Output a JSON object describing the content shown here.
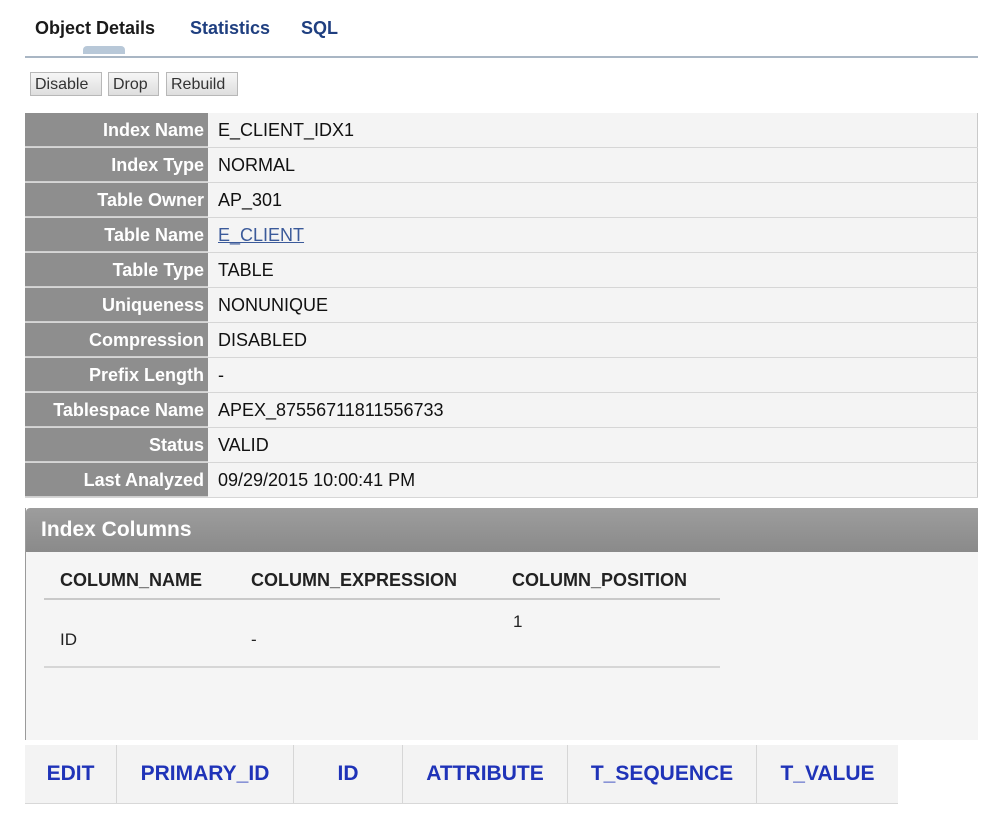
{
  "tabs": [
    "Object Details",
    "Statistics",
    "SQL"
  ],
  "toolbar": {
    "disable": "Disable",
    "drop": "Drop",
    "rebuild": "Rebuild"
  },
  "details": [
    {
      "label": "Index Name",
      "value": "E_CLIENT_IDX1"
    },
    {
      "label": "Index Type",
      "value": "NORMAL"
    },
    {
      "label": "Table Owner",
      "value": "AP_301"
    },
    {
      "label": "Table Name",
      "value": "E_CLIENT"
    },
    {
      "label": "Table Type",
      "value": "TABLE"
    },
    {
      "label": "Uniqueness",
      "value": "NONUNIQUE"
    },
    {
      "label": "Compression",
      "value": "DISABLED"
    },
    {
      "label": "Prefix Length",
      "value": "-"
    },
    {
      "label": "Tablespace Name",
      "value": "APEX_87556711811556733"
    },
    {
      "label": "Status",
      "value": "VALID"
    },
    {
      "label": "Last Analyzed",
      "value": "09/29/2015 10:00:41 PM"
    }
  ],
  "index_columns": {
    "title": "Index Columns",
    "headers": [
      "COLUMN_NAME",
      "COLUMN_EXPRESSION",
      "COLUMN_POSITION"
    ],
    "rows": [
      [
        "ID",
        "-",
        "1"
      ]
    ]
  },
  "bottom_headers": [
    "EDIT",
    "PRIMARY_ID",
    "ID",
    "ATTRIBUTE",
    "T_SEQUENCE",
    "T_VALUE"
  ]
}
